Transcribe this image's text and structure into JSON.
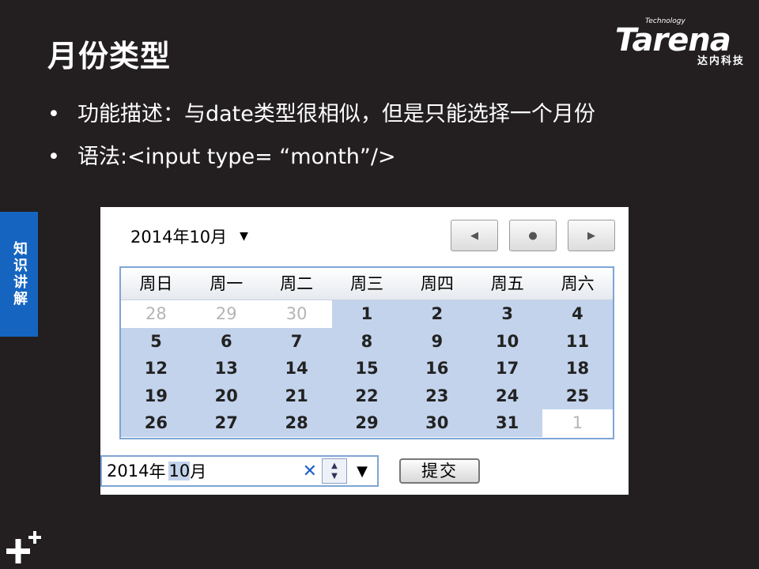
{
  "slide": {
    "title": "月份类型",
    "bullets": [
      "功能描述：与date类型很相似，但是只能选择一个月份",
      "语法:<input type= “month”/>"
    ],
    "side_tab": "知识讲解"
  },
  "logo": {
    "small": "Technology",
    "main": "Tarena",
    "sub": "达内科技"
  },
  "calendar": {
    "header": "2014年10月",
    "dropdown_icon": "▼",
    "nav": {
      "prev": "◀",
      "today": "●",
      "next": "▶"
    },
    "weekdays": [
      "周日",
      "周一",
      "周二",
      "周三",
      "周四",
      "周五",
      "周六"
    ],
    "days": [
      {
        "d": "28",
        "other": true
      },
      {
        "d": "29",
        "other": true
      },
      {
        "d": "30",
        "other": true
      },
      {
        "d": "1"
      },
      {
        "d": "2"
      },
      {
        "d": "3"
      },
      {
        "d": "4"
      },
      {
        "d": "5"
      },
      {
        "d": "6"
      },
      {
        "d": "7"
      },
      {
        "d": "8"
      },
      {
        "d": "9"
      },
      {
        "d": "10"
      },
      {
        "d": "11"
      },
      {
        "d": "12"
      },
      {
        "d": "13"
      },
      {
        "d": "14"
      },
      {
        "d": "15"
      },
      {
        "d": "16"
      },
      {
        "d": "17"
      },
      {
        "d": "18"
      },
      {
        "d": "19"
      },
      {
        "d": "20"
      },
      {
        "d": "21"
      },
      {
        "d": "22"
      },
      {
        "d": "23"
      },
      {
        "d": "24"
      },
      {
        "d": "25"
      },
      {
        "d": "26"
      },
      {
        "d": "27"
      },
      {
        "d": "28"
      },
      {
        "d": "29"
      },
      {
        "d": "30"
      },
      {
        "d": "31"
      },
      {
        "d": "1",
        "other": true
      }
    ]
  },
  "month_input": {
    "year": "2014",
    "year_unit": "年",
    "month": "10",
    "month_unit": "月",
    "clear_icon": "✕",
    "spin_up": "▲",
    "spin_down": "▼",
    "dropdown_icon": "▼"
  },
  "submit_label": "提交",
  "colors": {
    "background": "#231f20",
    "side_tab": "#1565c0",
    "selection": "#c3d3ec",
    "border": "#7fa5d6"
  }
}
